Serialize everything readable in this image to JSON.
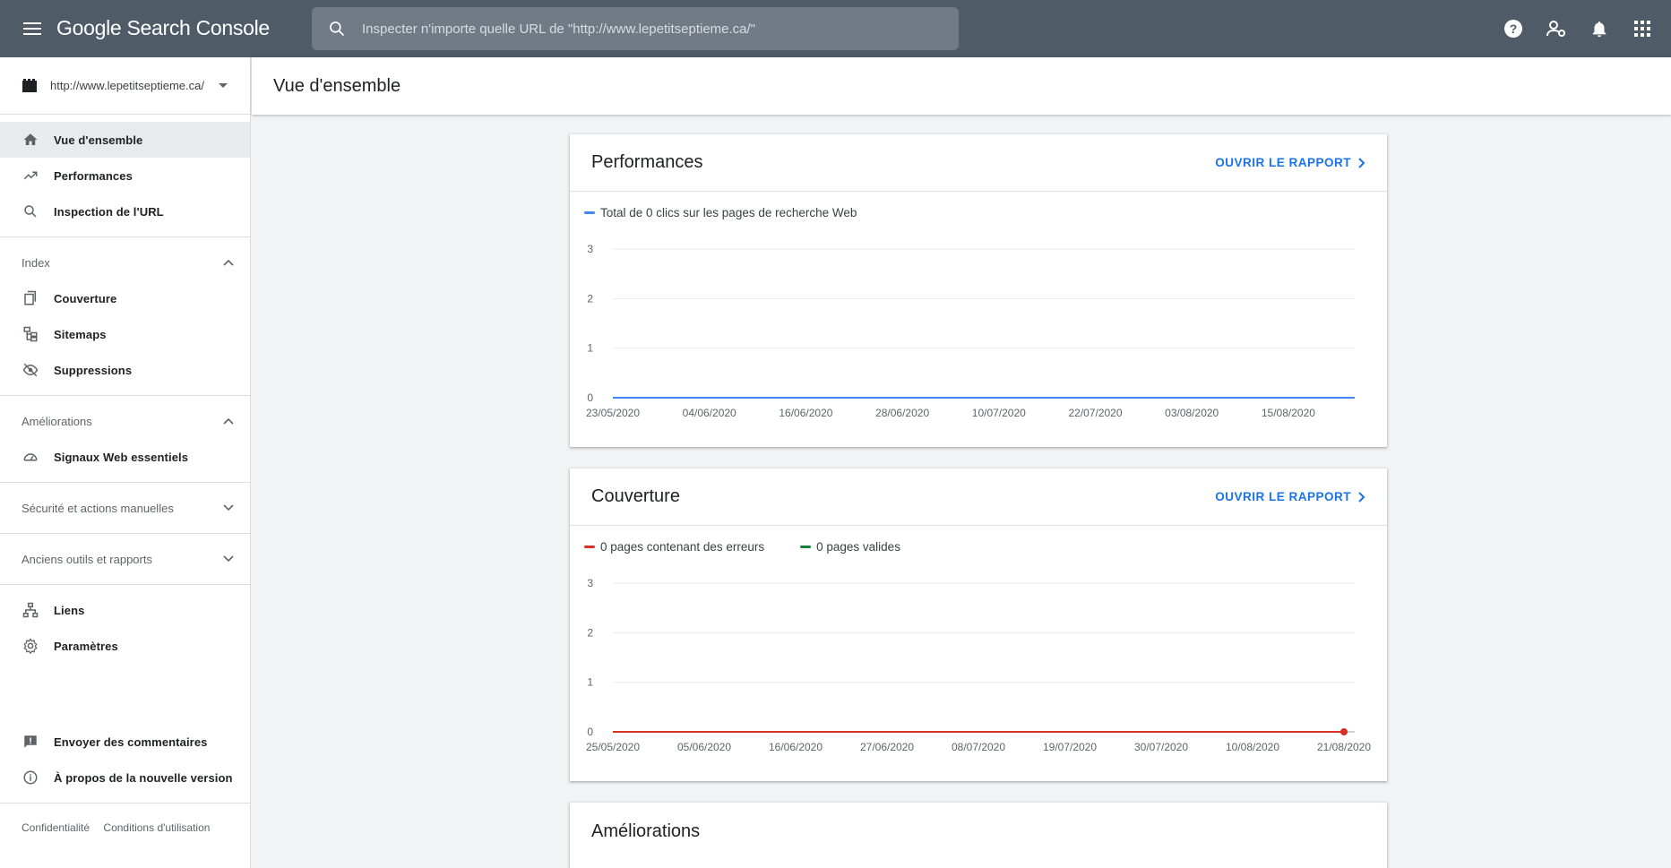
{
  "app": {
    "title": "Google Search Console",
    "search_placeholder": "Inspecter n'importe quelle URL de \"http://www.lepetitseptieme.ca/\""
  },
  "topbar_icons": [
    "help-icon",
    "manage-users-icon",
    "notifications-icon",
    "apps-grid-icon"
  ],
  "sidebar": {
    "property": "http://www.lepetitseptieme.ca/",
    "main_items": [
      {
        "label": "Vue d'ensemble",
        "icon": "home-icon",
        "active": true
      },
      {
        "label": "Performances",
        "icon": "trending-up-icon"
      },
      {
        "label": "Inspection de l'URL",
        "icon": "search-icon"
      }
    ],
    "sections": [
      {
        "label": "Index",
        "expanded": true,
        "items": [
          {
            "label": "Couverture",
            "icon": "copy-pages-icon"
          },
          {
            "label": "Sitemaps",
            "icon": "sitemap-icon"
          },
          {
            "label": "Suppressions",
            "icon": "eye-off-icon"
          }
        ]
      },
      {
        "label": "Améliorations",
        "expanded": true,
        "items": [
          {
            "label": "Signaux Web essentiels",
            "icon": "speed-gauge-icon"
          }
        ]
      },
      {
        "label": "Sécurité et actions manuelles",
        "expanded": false,
        "items": []
      },
      {
        "label": "Anciens outils et rapports",
        "expanded": false,
        "items": []
      }
    ],
    "bottom_items": [
      {
        "label": "Liens",
        "icon": "links-icon"
      },
      {
        "label": "Paramètres",
        "icon": "settings-gear-icon"
      }
    ],
    "extra_items": [
      {
        "label": "Envoyer des commentaires",
        "icon": "feedback-icon"
      },
      {
        "label": "À propos de la nouvelle version",
        "icon": "info-icon"
      }
    ],
    "footer": {
      "privacy": "Confidentialité",
      "terms": "Conditions d'utilisation"
    }
  },
  "main": {
    "page_title": "Vue d'ensemble",
    "cards": [
      {
        "title": "Performances",
        "link": "OUVRIR LE RAPPORT"
      },
      {
        "title": "Couverture",
        "link": "OUVRIR LE RAPPORT"
      },
      {
        "title": "Améliorations"
      }
    ]
  },
  "colors": {
    "topbar": "#4f5b66",
    "accent_blue": "#1a73e8",
    "clicks_line": "#4285f4",
    "error_red": "#d93025",
    "valid_green": "#188038"
  },
  "chart_data": [
    {
      "type": "line",
      "title": "Performances",
      "x": [
        "23/05/2020",
        "04/06/2020",
        "16/06/2020",
        "28/06/2020",
        "10/07/2020",
        "22/07/2020",
        "03/08/2020",
        "15/08/2020"
      ],
      "series": [
        {
          "name": "Total de 0 clics sur les pages de recherche Web",
          "color": "#4285f4",
          "values": [
            0,
            0,
            0,
            0,
            0,
            0,
            0,
            0
          ]
        }
      ],
      "yticks": [
        0,
        1,
        2,
        3
      ],
      "ylim": [
        0,
        3
      ],
      "grid": true,
      "legend": "top-left"
    },
    {
      "type": "line",
      "title": "Couverture",
      "x": [
        "25/05/2020",
        "05/06/2020",
        "16/06/2020",
        "27/06/2020",
        "08/07/2020",
        "19/07/2020",
        "30/07/2020",
        "10/08/2020",
        "21/08/2020"
      ],
      "series": [
        {
          "name": "0 pages contenant des erreurs",
          "color": "#d93025",
          "values": [
            0,
            0,
            0,
            0,
            0,
            0,
            0,
            0,
            0
          ]
        },
        {
          "name": "0 pages valides",
          "color": "#188038",
          "values": [
            0,
            0,
            0,
            0,
            0,
            0,
            0,
            0,
            0
          ]
        }
      ],
      "yticks": [
        0,
        1,
        2,
        3
      ],
      "ylim": [
        0,
        3
      ],
      "grid": true,
      "legend": "top-left"
    }
  ]
}
